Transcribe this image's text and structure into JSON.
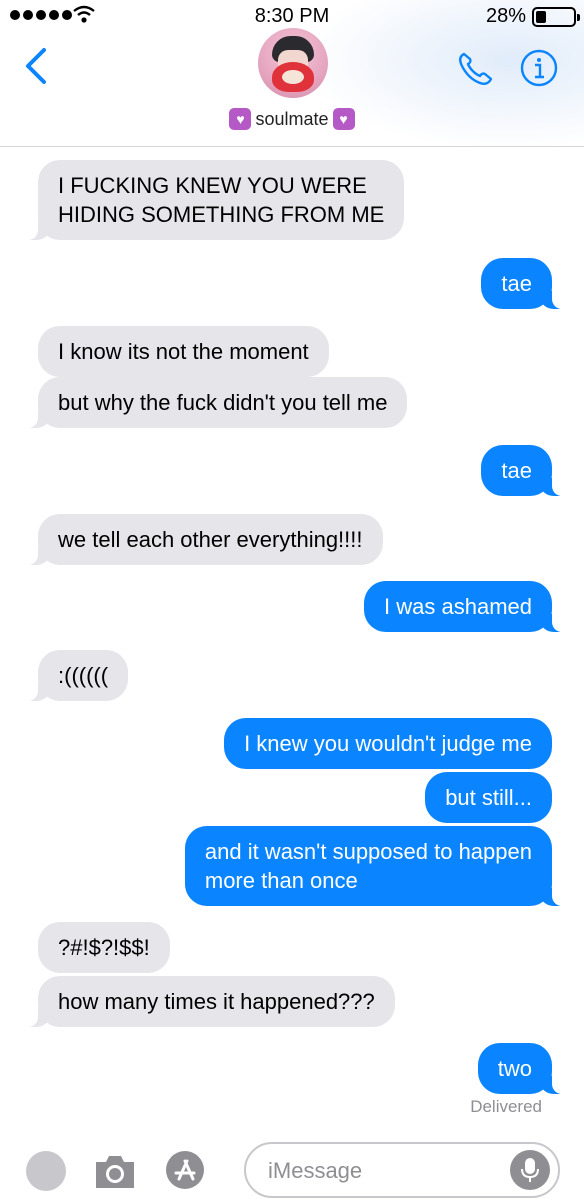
{
  "status_bar": {
    "time": "8:30 PM",
    "battery_percent_text": "28%",
    "battery_level": 0.28
  },
  "header": {
    "contact_name": "soulmate",
    "name_emoji": "♥",
    "icons": {
      "back": "chevron-left-icon",
      "call": "phone-icon",
      "info": "info-icon"
    },
    "accent_color": "#0a84ff"
  },
  "messages": [
    {
      "direction": "in",
      "text": "I FUCKING KNEW YOU WERE\nHIDING SOMETHING FROM ME"
    },
    {
      "direction": "out",
      "text": "tae"
    },
    {
      "direction": "in",
      "text": "I know its not the moment"
    },
    {
      "direction": "in",
      "text": "but why the fuck didn't you tell me"
    },
    {
      "direction": "out",
      "text": "tae"
    },
    {
      "direction": "in",
      "text": "we tell each other everything!!!!"
    },
    {
      "direction": "out",
      "text": "I was ashamed"
    },
    {
      "direction": "in",
      "text": ":(((((("
    },
    {
      "direction": "out",
      "text": "I knew you wouldn't judge me"
    },
    {
      "direction": "out",
      "text": "but still..."
    },
    {
      "direction": "out",
      "text": "and it wasn't supposed to happen\nmore than once"
    },
    {
      "direction": "in",
      "text": "?#!$?!$$!"
    },
    {
      "direction": "in",
      "text": "how many times it happened???"
    },
    {
      "direction": "out",
      "text": "two"
    }
  ],
  "delivered_label": "Delivered",
  "input_bar": {
    "placeholder": "iMessage",
    "value": "",
    "icons": [
      "digital-touch-icon",
      "camera-icon",
      "app-store-icon",
      "microphone-icon"
    ]
  },
  "colors": {
    "incoming_bubble": "#e5e5ea",
    "outgoing_bubble": "#0a84ff",
    "meta_text": "#8e8e93"
  }
}
